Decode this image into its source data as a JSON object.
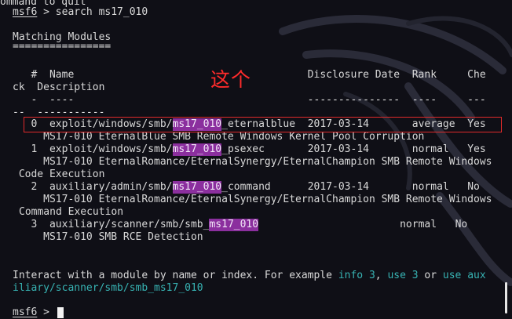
{
  "header": {
    "cut_line": "ommand to quit",
    "prompt": "msf6",
    "command": " > search ms17_010"
  },
  "matching_modules": {
    "title": "Matching Modules",
    "underline": "================",
    "head1": "   #  Name                                      Disclosure Date  Rank     Che",
    "head2": "ck  Description",
    "rule1": "   -  ----                                      ---------------  ----     ---",
    "rule2": "--  -----------"
  },
  "rows": [
    {
      "num": "   0  ",
      "pre": "exploit/windows/smb/",
      "hl": "ms17_010",
      "post": "_eternalblue  ",
      "date": "2017-03-14       ",
      "rank": "average  ",
      "check": "Yes",
      "desc1": "     MS17-010 EternalBlue SMB Remote Windows Kernel Pool Corruption",
      "desc2": ""
    },
    {
      "num": "   1  ",
      "pre": "exploit/windows/smb/",
      "hl": "ms17_010",
      "post": "_psexec       ",
      "date": "2017-03-14       ",
      "rank": "normal   ",
      "check": "Yes",
      "desc1": "     MS17-010 EternalRomance/EternalSynergy/EternalChampion SMB Remote Windows",
      "desc2": " Code Execution"
    },
    {
      "num": "   2  ",
      "pre": "auxiliary/admin/smb/",
      "hl": "ms17_010",
      "post": "_command      ",
      "date": "2017-03-14       ",
      "rank": "normal   ",
      "check": "No",
      "desc1": "     MS17-010 EternalRomance/EternalSynergy/EternalChampion SMB Remote Windows",
      "desc2": "Command Execution"
    },
    {
      "num": "   3  ",
      "pre": "auxiliary/scanner/smb/smb_",
      "hl": "ms17_010",
      "post": "                       ",
      "date": "",
      "rank": "normal   ",
      "check": "No",
      "desc1": "     MS17-010 SMB RCE Detection",
      "desc2": ""
    }
  ],
  "footer": {
    "interact_prefix": "Interact with a module by name or index. For example ",
    "info_cmd": "info 3",
    "sep1": ", ",
    "use_cmd": "use 3",
    "or_word": " or ",
    "use_aux_part1": "use aux",
    "use_aux_part2": "iliary/scanner/smb/smb_ms17_010",
    "prompt": "msf6",
    "prompt_tail": " > "
  },
  "annotation": {
    "note_text": "这个"
  },
  "colors": {
    "background": "#0f0f16",
    "text": "#d9d9d9",
    "highlight": "#8b2f9e",
    "link": "#37b3b3",
    "annotation": "#ff2b2b"
  },
  "icons": {
    "cursor": "block-cursor",
    "background": "kali-dragon-watermark"
  }
}
